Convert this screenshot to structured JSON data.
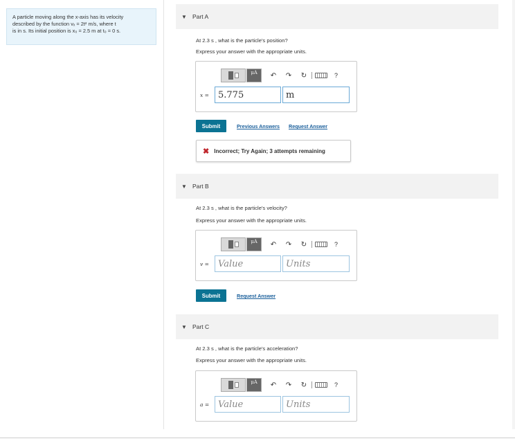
{
  "problem": {
    "text_line1": "A particle moving along the x-axis has its velocity",
    "text_line2": "described by the function vₓ = 2t² m/s, where t",
    "text_line3": "is in s. Its initial position is x₀ = 2.5 m at t₀ = 0 s."
  },
  "toolbar": {
    "mu_label": "μA",
    "help_label": "?"
  },
  "parts": [
    {
      "header": "Part A",
      "question": "At 2.3 s , what is the particle's position?",
      "instruction": "Express your answer with the appropriate units.",
      "variable": "x =",
      "value": "5.775",
      "unit": "m",
      "submit_label": "Submit",
      "previous_answers_label": "Previous Answers",
      "request_answer_label": "Request Answer",
      "feedback": "Incorrect; Try Again; 3 attempts remaining"
    },
    {
      "header": "Part B",
      "question": "At 2.3 s , what is the particle's velocity?",
      "instruction": "Express your answer with the appropriate units.",
      "variable": "v =",
      "value_placeholder": "Value",
      "unit_placeholder": "Units",
      "submit_label": "Submit",
      "request_answer_label": "Request Answer"
    },
    {
      "header": "Part C",
      "question": "At 2.3 s , what is the particle's acceleration?",
      "instruction": "Express your answer with the appropriate units.",
      "variable": "a =",
      "value_placeholder": "Value",
      "unit_placeholder": "Units"
    }
  ],
  "colors": {
    "submit": "#0b7393",
    "link": "#1a5f9b",
    "error": "#c0272d",
    "panel": "#e8f4fb"
  }
}
